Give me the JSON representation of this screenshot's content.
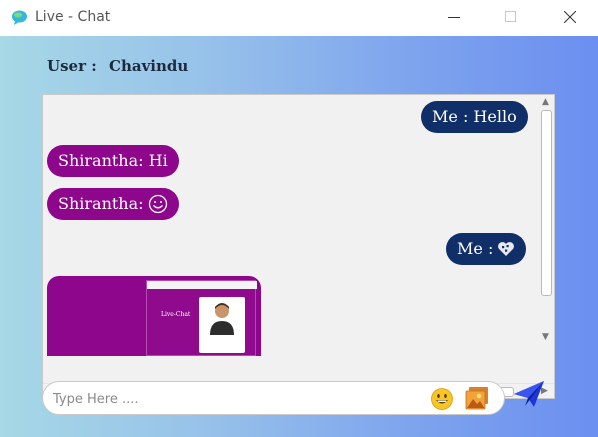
{
  "window": {
    "title": "Live - Chat",
    "icon": "chat-bubble-icon",
    "controls": [
      "minimize-icon",
      "maximize-icon",
      "close-icon"
    ]
  },
  "header": {
    "user_label": "User :",
    "user_name": "Chavindu"
  },
  "messages": [
    {
      "sender": "me",
      "text": "Me : Hello"
    },
    {
      "sender": "them",
      "text": "Shirantha: Hi"
    },
    {
      "sender": "them",
      "text": "Shirantha:",
      "emoji": "smiley-icon"
    },
    {
      "sender": "me",
      "text": "Me :",
      "emoji": "heart-icon"
    },
    {
      "sender": "them",
      "type": "image",
      "image": "screenshot-thumbnail",
      "caption": "Live-Chat"
    }
  ],
  "composer": {
    "placeholder": "Type Here ....",
    "value": "",
    "emoji_icon": "grinning-face-icon",
    "image_icon": "image-attach-icon",
    "send_icon": "paper-plane-icon"
  },
  "colors": {
    "me_bubble": "#102f69",
    "them_bubble": "#8e068c",
    "gradient_start": "#a6d8e6",
    "gradient_end": "#6b8ff0"
  }
}
